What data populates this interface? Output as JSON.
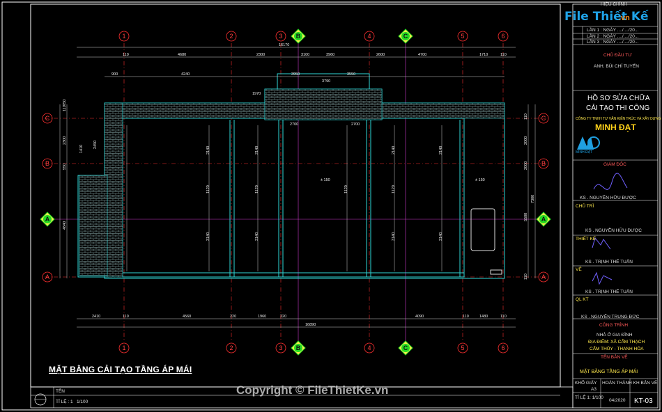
{
  "colors": {
    "frame": "#ffffff",
    "wall": "#2fd8d8",
    "axis_red": "#ff3030",
    "axis_magenta": "#d23bd2",
    "dim": "#d8d8d8",
    "hatch": "#9bbcbc",
    "yellow": "#ffe94d",
    "green": "#22dd22"
  },
  "logo": {
    "part1": "File Thiết Kế",
    "part2": ".vn"
  },
  "watermark": "Copyright © FileThietKe.vn",
  "sheet_title": "MẶT BẰNG CẢI TẠO TẦNG ÁP MÁI",
  "grid_top": [
    "1",
    "2",
    "3",
    "B",
    "4",
    "C",
    "5",
    "6"
  ],
  "grid_left": [
    "C",
    "B",
    "A",
    "A"
  ],
  "grid_right": [
    "C",
    "B",
    "A",
    "A"
  ],
  "dims_top": [
    "110",
    "4680",
    "2300",
    "3100",
    "3960",
    "2600",
    "4700",
    "1710",
    "110",
    "16170",
    "900",
    "4240",
    "3950",
    "3550",
    "1970",
    "3790",
    "2700",
    "2700"
  ],
  "dims_bottom": [
    "2410",
    "110",
    "4560",
    "220",
    "1960",
    "220",
    "4090",
    "110",
    "1480",
    "110",
    "16890"
  ],
  "dims_left": [
    "110",
    "750",
    "2300",
    "1410",
    "2450",
    "550",
    "4840"
  ],
  "dims_right": [
    "110",
    "2000",
    "2000",
    "5500",
    "7300",
    "110"
  ],
  "room_labels": [
    "2140",
    "2140",
    "1120",
    "1120",
    "3140",
    "3140",
    "2140",
    "2140",
    "1120",
    "3140",
    "3140",
    "1120"
  ],
  "level_marks": [
    "± 150",
    "± 150"
  ],
  "revision": {
    "title": "HIỆU CHỈNH",
    "rows": [
      "LẦN 1 : NGÀY ..../..../20...",
      "LẦN 2 : NGÀY ..../..../20...",
      "LẦN 3 : NGÀY ..../..../20..."
    ]
  },
  "owner": {
    "label": "CHỦ ĐẦU TƯ",
    "name": "ANH. BÙI CHÍ TUYẾN"
  },
  "doc_type": [
    "HỒ SƠ SỬA CHỮA",
    "CẢI TẠO THI CÔNG"
  ],
  "company": {
    "line": "CÔNG TY TNHH TƯ VẤN KIẾN TRÚC VÀ XÂY DỰNG",
    "name": "MINH ĐẠT",
    "abbr": "MINH ĐẠT"
  },
  "signatures": [
    {
      "role": "GIÁM ĐỐC",
      "name": "KS . NGUYỄN HỮU ĐƯỢC"
    },
    {
      "role": "CHỦ TRÌ",
      "name": "KS . NGUYỄN HỮU ĐƯỢC"
    },
    {
      "role": "THIẾT KẾ",
      "name": "KS . TRỊNH THẾ TUẤN"
    },
    {
      "role": "VẼ",
      "name": "KS . TRỊNH THẾ TUẤN"
    },
    {
      "role": "QL KT",
      "name": "KS . NGUYỄN TRUNG ĐỨC"
    }
  ],
  "project": {
    "label": "CÔNG TRÌNH",
    "name": "NHÀ Ở GIA ĐÌNH",
    "address": "ĐỊA ĐIỂM: XÃ CẨM THẠCH",
    "address2": "CẨM THỦY - THANH HÓA"
  },
  "drawing_name": {
    "label": "TÊN BẢN VẼ",
    "value": "MẶT BẰNG TẦNG ÁP MÁI"
  },
  "footer": {
    "size_label": "KHỔ GIẤY",
    "size": "A3",
    "date_label": "HOÀN THÀNH KH BẢN VẼ",
    "date": "04/2020",
    "scale_label": "TỈ LỆ 1: 1/100",
    "code": "KT-03",
    "bottom_name": "TÊN",
    "bottom_scale": "TỈ LỆ : 1",
    "bottom_scale_val": "1/100"
  }
}
